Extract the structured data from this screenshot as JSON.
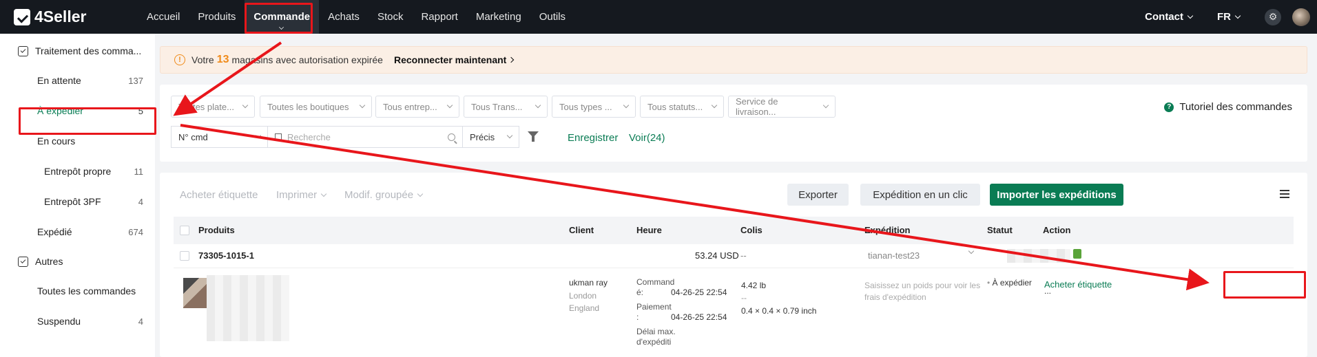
{
  "app": {
    "name": "4Seller"
  },
  "nav": {
    "items": [
      "Accueil",
      "Produits",
      "Commande",
      "Achats",
      "Stock",
      "Rapport",
      "Marketing",
      "Outils"
    ],
    "active": "Commande",
    "contact": "Contact",
    "lang": "FR"
  },
  "sidebar": {
    "group1": "Traitement des comma...",
    "items": [
      {
        "label": "En attente",
        "count": "137"
      },
      {
        "label": "À expédier",
        "count": "5"
      },
      {
        "label": "En cours",
        "count": ""
      },
      {
        "label": "Entrepôt propre",
        "count": "11"
      },
      {
        "label": "Entrepôt 3PF",
        "count": "4"
      },
      {
        "label": "Expédié",
        "count": "674"
      }
    ],
    "group2": "Autres",
    "items2": [
      {
        "label": "Toutes les commandes",
        "count": ""
      },
      {
        "label": "Suspendu",
        "count": "4"
      }
    ]
  },
  "alert": {
    "prefix": "Votre",
    "count": "13",
    "suffix": "magasins avec autorisation expirée",
    "action": "Reconnecter maintenant"
  },
  "filters": {
    "dropdowns": [
      "Toutes plate...",
      "Toutes les boutiques",
      "Tous entrep...",
      "Tous Trans...",
      "Tous types ...",
      "Tous statuts...",
      "Service de livraison..."
    ],
    "tutorial": "Tutoriel des commandes",
    "search_field": "N° cmd",
    "search_placeholder": "Recherche",
    "match": "Précis",
    "save": "Enregistrer",
    "view": "Voir(24)"
  },
  "toolbar": {
    "buy_label": "Acheter étiquette",
    "print": "Imprimer",
    "bulk_edit": "Modif. groupée",
    "export": "Exporter",
    "one_click": "Expédition en un clic",
    "import": "Importer les expéditions"
  },
  "table": {
    "headers": [
      "Produits",
      "Client",
      "Heure",
      "Colis",
      "Expédition",
      "Statut",
      "Action"
    ],
    "order": {
      "id": "73305-1015-1",
      "amount": "53.24 USD",
      "colis": "--",
      "carrier": "tianan-test23"
    },
    "row": {
      "client_name": "ukman ray",
      "client_city": "London",
      "client_region": "England",
      "time_cmd_label": "Command\né:",
      "time_cmd": "04-26-25 22:54",
      "time_pay_label": "Paiement\n:",
      "time_pay": "04-26-25 22:54",
      "time_delay_label": "Délai max.\nd'expéditi",
      "weight": "4.42 lb",
      "dash": "--",
      "dims": "0.4 × 0.4 × 0.79 inch",
      "shipping_hint": "Saisissez un poids pour voir les frais d'expédition",
      "status": "À expédier",
      "action": "Acheter étiquette",
      "more": "..."
    }
  },
  "colors": {
    "accent": "#0a7c54",
    "annotation": "#e8161b",
    "warning": "#f08b1a"
  }
}
